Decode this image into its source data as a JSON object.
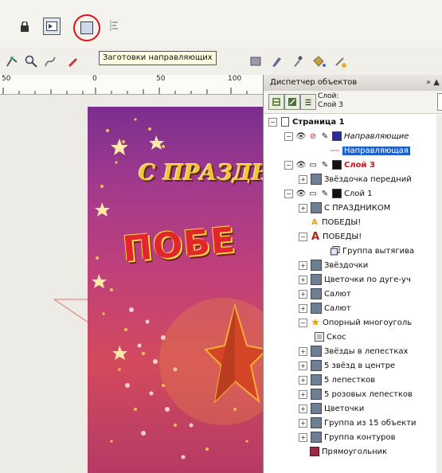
{
  "tooltip": "Заготовки направляющих",
  "ruler": {
    "labels": [
      "50",
      "0",
      "50",
      "100"
    ]
  },
  "poster": {
    "title_line1": "С ПРАЗДН",
    "title_line2": "ПОБЕ"
  },
  "panel": {
    "title": "Диспетчер объектов",
    "controls": "» ▲",
    "layer_caption": "Слой:",
    "layer_name": "Слой 3"
  },
  "tree": [
    {
      "label": "Страница 1",
      "bold": true
    },
    {
      "label": "Направляющие"
    },
    {
      "label": "Направляющая",
      "selected": true
    },
    {
      "label": "Слой 3",
      "red": true
    },
    {
      "label": "Звёздочка передний"
    },
    {
      "label": "Слой 1"
    },
    {
      "label": "С ПРАЗДНИКОМ"
    },
    {
      "label": "ПОБЕДЫ!"
    },
    {
      "label": "ПОБЕДЫ!"
    },
    {
      "label": "Группа вытягива"
    },
    {
      "label": "Звёздочки"
    },
    {
      "label": "Цветочки по дуге-уч"
    },
    {
      "label": "Салют"
    },
    {
      "label": "Салют"
    },
    {
      "label": "Опорный многоуголь"
    },
    {
      "label": "Скос"
    },
    {
      "label": "Звёзды в лепестках"
    },
    {
      "label": "5 звёзд в центре"
    },
    {
      "label": "5 лепестков"
    },
    {
      "label": "5 розовых лепестков"
    },
    {
      "label": "Цветочки"
    },
    {
      "label": "Группа из 15 объекти"
    },
    {
      "label": "Группа контуров"
    },
    {
      "label": "Прямоугольник"
    }
  ]
}
